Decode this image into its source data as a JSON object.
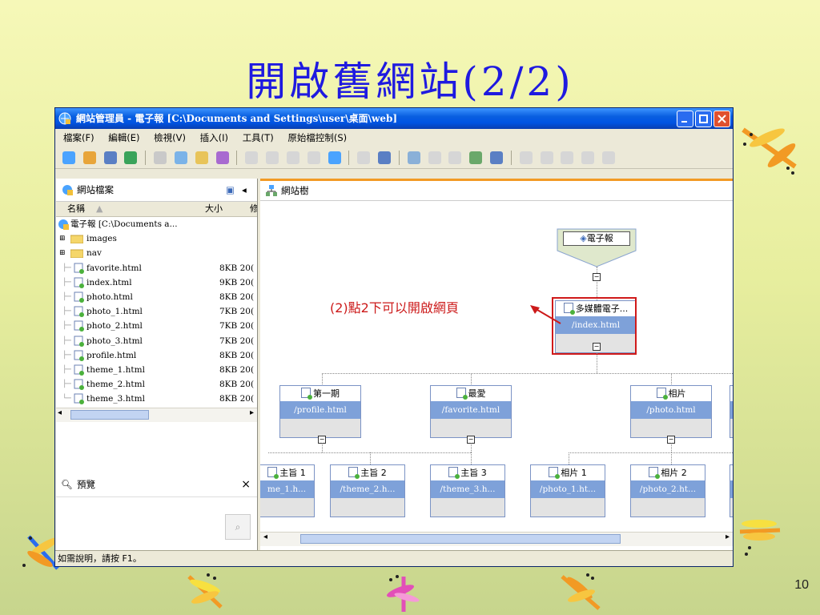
{
  "slide": {
    "title": "開啟舊網站(2/2)",
    "page": "10"
  },
  "window": {
    "title": "網站管理員 - 電子報 [C:\\Documents and Settings\\user\\桌面\\web]",
    "menu": [
      "檔案(F)",
      "編輯(E)",
      "檢視(V)",
      "插入(I)",
      "工具(T)",
      "原始檔控制(S)"
    ]
  },
  "left_pane": {
    "title": "網站檔案",
    "columns": {
      "name": "名稱",
      "size": "大小",
      "extra": "修"
    },
    "root": "電子報 [C:\\Documents a...",
    "folders": [
      "images",
      "nav"
    ],
    "files": [
      {
        "name": "favorite.html",
        "size": "8KB 20("
      },
      {
        "name": "index.html",
        "size": "9KB 20("
      },
      {
        "name": "photo.html",
        "size": "8KB 20("
      },
      {
        "name": "photo_1.html",
        "size": "7KB 20("
      },
      {
        "name": "photo_2.html",
        "size": "7KB 20("
      },
      {
        "name": "photo_3.html",
        "size": "7KB 20("
      },
      {
        "name": "profile.html",
        "size": "8KB 20("
      },
      {
        "name": "theme_1.html",
        "size": "8KB 20("
      },
      {
        "name": "theme_2.html",
        "size": "8KB 20("
      },
      {
        "name": "theme_3.html",
        "size": "8KB 20("
      }
    ]
  },
  "preview": {
    "title": "預覽",
    "close": "×"
  },
  "status": "如需說明，請按 F1。",
  "right_pane": {
    "title": "網站樹",
    "root_node": "電子報",
    "home": {
      "title": "多媒體電子...",
      "url": "/index.html"
    },
    "level1": [
      {
        "title": "第一期",
        "url": "/profile.html"
      },
      {
        "title": "最愛",
        "url": "/favorite.html"
      },
      {
        "title": "相片",
        "url": "/photo.html"
      }
    ],
    "level2": [
      {
        "title": "主旨 1",
        "url": "me_1.h..."
      },
      {
        "title": "主旨 2",
        "url": "/theme_2.h..."
      },
      {
        "title": "主旨 3",
        "url": "/theme_3.h..."
      },
      {
        "title": "相片 1",
        "url": "/photo_1.ht..."
      },
      {
        "title": "相片 2",
        "url": "/photo_2.ht..."
      }
    ]
  },
  "annotation": "(2)點2下可以開啟網頁",
  "colors": {
    "title": "#1f1ae0",
    "annotation": "#cc1a1a",
    "xp_blue": "#0054e3",
    "node_url_bg": "#7ea1d9"
  }
}
